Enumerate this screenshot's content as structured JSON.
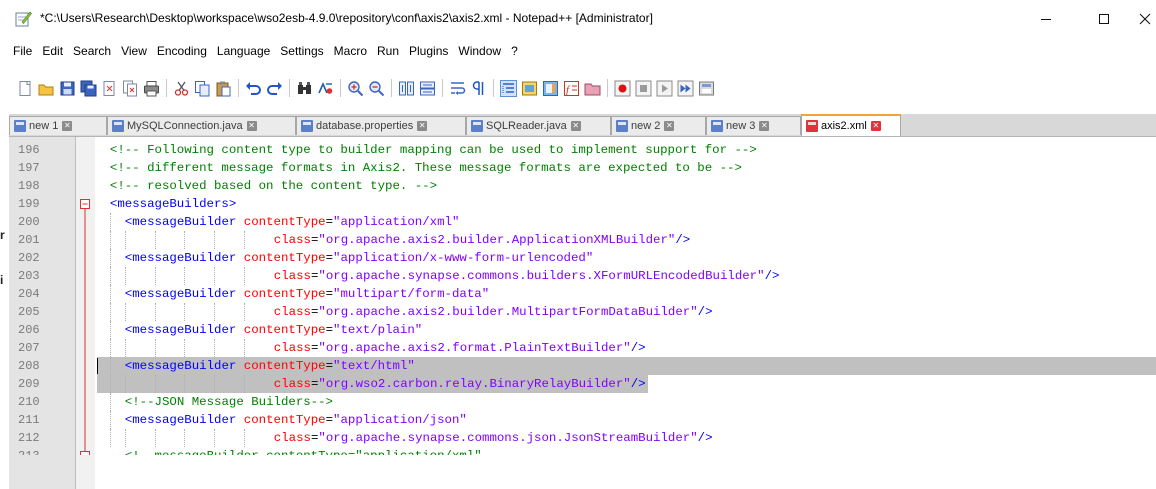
{
  "window": {
    "title": "*C:\\Users\\Research\\Desktop\\workspace\\wso2esb-4.9.0\\repository\\conf\\axis2\\axis2.xml - Notepad++ [Administrator]",
    "minimize_icon": "minimize-icon",
    "maximize_icon": "maximize-icon",
    "close_icon": "close-icon"
  },
  "left_edge": [
    "r",
    "i"
  ],
  "menu": [
    "File",
    "Edit",
    "Search",
    "View",
    "Encoding",
    "Language",
    "Settings",
    "Macro",
    "Run",
    "Plugins",
    "Window",
    "?"
  ],
  "toolbar": [
    {
      "name": "new-file-icon",
      "type": "btn"
    },
    {
      "name": "open-file-icon",
      "type": "btn"
    },
    {
      "name": "save-icon",
      "type": "btn"
    },
    {
      "name": "save-all-icon",
      "type": "btn"
    },
    {
      "name": "close-file-icon",
      "type": "btn"
    },
    {
      "name": "close-all-icon",
      "type": "btn"
    },
    {
      "name": "print-icon",
      "type": "btn"
    },
    {
      "type": "sep"
    },
    {
      "name": "cut-icon",
      "type": "btn"
    },
    {
      "name": "copy-icon",
      "type": "btn"
    },
    {
      "name": "paste-icon",
      "type": "btn"
    },
    {
      "type": "sep"
    },
    {
      "name": "undo-icon",
      "type": "btn"
    },
    {
      "name": "redo-icon",
      "type": "btn"
    },
    {
      "type": "sep"
    },
    {
      "name": "find-icon",
      "type": "btn"
    },
    {
      "name": "replace-icon",
      "type": "btn"
    },
    {
      "type": "sep"
    },
    {
      "name": "zoom-in-icon",
      "type": "btn"
    },
    {
      "name": "zoom-out-icon",
      "type": "btn"
    },
    {
      "type": "sep"
    },
    {
      "name": "sync-vertical-icon",
      "type": "btn"
    },
    {
      "name": "sync-horizontal-icon",
      "type": "btn"
    },
    {
      "type": "sep"
    },
    {
      "name": "word-wrap-icon",
      "type": "btn"
    },
    {
      "name": "show-all-characters-icon",
      "type": "btn"
    },
    {
      "type": "sep"
    },
    {
      "name": "indent-guide-icon",
      "type": "btn",
      "active": true
    },
    {
      "name": "user-defined-language-icon",
      "type": "btn"
    },
    {
      "name": "document-map-icon",
      "type": "btn"
    },
    {
      "name": "function-list-icon",
      "type": "btn"
    },
    {
      "name": "folder-as-workspace-icon",
      "type": "btn"
    },
    {
      "type": "sep"
    },
    {
      "name": "record-macro-icon",
      "type": "btn"
    },
    {
      "name": "stop-recording-icon",
      "type": "btn"
    },
    {
      "name": "play-macro-icon",
      "type": "btn"
    },
    {
      "name": "run-macro-multiple-icon",
      "type": "btn"
    },
    {
      "name": "save-macro-icon",
      "type": "btn"
    }
  ],
  "tabs": [
    {
      "label": "new 1",
      "color": "#5b7fc9",
      "active": false
    },
    {
      "label": "MySQLConnection.java",
      "color": "#5b7fc9",
      "active": false
    },
    {
      "label": "database.properties",
      "color": "#5b7fc9",
      "active": false
    },
    {
      "label": "SQLReader.java",
      "color": "#5b7fc9",
      "active": false
    },
    {
      "label": "new 2",
      "color": "#5b7fc9",
      "active": false
    },
    {
      "label": "new 3",
      "color": "#5b7fc9",
      "active": false
    },
    {
      "label": "axis2.xml",
      "color": "#e0343d",
      "active": true
    }
  ],
  "colors": {
    "comment": "#008000",
    "tag": "#0000ff",
    "attribute": "#ff0000",
    "string": "#8000ff",
    "selection": "#c0c0c0",
    "fold_marker": "#e03030"
  },
  "lines": [
    {
      "num": "196",
      "indent": 2,
      "tokens": [
        [
          "cm",
          "<!-- Following content type to builder mapping can be used to implement support for -->"
        ]
      ]
    },
    {
      "num": "197",
      "indent": 2,
      "tokens": [
        [
          "cm",
          "<!-- different message formats in Axis2. These message formats are expected to be -->"
        ]
      ]
    },
    {
      "num": "198",
      "indent": 2,
      "tokens": [
        [
          "cm",
          "<!-- resolved based on the content type. -->"
        ]
      ]
    },
    {
      "num": "199",
      "indent": 2,
      "fold": "open",
      "tokens": [
        [
          "tg",
          "<messageBuilders>"
        ]
      ]
    },
    {
      "num": "200",
      "indent": 4,
      "tokens": [
        [
          "tg",
          "<messageBuilder "
        ],
        [
          "at",
          "contentType"
        ],
        [
          "eq",
          "="
        ],
        [
          "st",
          "\"application/xml\""
        ]
      ]
    },
    {
      "num": "201",
      "indent": 4,
      "cont": true,
      "tokens": [
        [
          "at",
          "class"
        ],
        [
          "eq",
          "="
        ],
        [
          "st",
          "\"org.apache.axis2.builder.ApplicationXMLBuilder\""
        ],
        [
          "tg",
          "/>"
        ]
      ]
    },
    {
      "num": "202",
      "indent": 4,
      "tokens": [
        [
          "tg",
          "<messageBuilder "
        ],
        [
          "at",
          "contentType"
        ],
        [
          "eq",
          "="
        ],
        [
          "st",
          "\"application/x-www-form-urlencoded\""
        ]
      ]
    },
    {
      "num": "203",
      "indent": 4,
      "cont": true,
      "tokens": [
        [
          "at",
          "class"
        ],
        [
          "eq",
          "="
        ],
        [
          "st",
          "\"org.apache.synapse.commons.builders.XFormURLEncodedBuilder\""
        ],
        [
          "tg",
          "/>"
        ]
      ]
    },
    {
      "num": "204",
      "indent": 4,
      "tokens": [
        [
          "tg",
          "<messageBuilder "
        ],
        [
          "at",
          "contentType"
        ],
        [
          "eq",
          "="
        ],
        [
          "st",
          "\"multipart/form-data\""
        ]
      ]
    },
    {
      "num": "205",
      "indent": 4,
      "cont": true,
      "tokens": [
        [
          "at",
          "class"
        ],
        [
          "eq",
          "="
        ],
        [
          "st",
          "\"org.apache.axis2.builder.MultipartFormDataBuilder\""
        ],
        [
          "tg",
          "/>"
        ]
      ]
    },
    {
      "num": "206",
      "indent": 4,
      "tokens": [
        [
          "tg",
          "<messageBuilder "
        ],
        [
          "at",
          "contentType"
        ],
        [
          "eq",
          "="
        ],
        [
          "st",
          "\"text/plain\""
        ]
      ]
    },
    {
      "num": "207",
      "indent": 4,
      "cont": true,
      "tokens": [
        [
          "at",
          "class"
        ],
        [
          "eq",
          "="
        ],
        [
          "st",
          "\"org.apache.axis2.format.PlainTextBuilder\""
        ],
        [
          "tg",
          "/>"
        ]
      ]
    },
    {
      "num": "208",
      "indent": 4,
      "selected": true,
      "caret": true,
      "tokens": [
        [
          "tg",
          "<messageBuilder "
        ],
        [
          "at",
          "contentType"
        ],
        [
          "eq",
          "="
        ],
        [
          "st",
          "\"text/html\""
        ]
      ]
    },
    {
      "num": "209",
      "indent": 4,
      "cont": true,
      "selected": true,
      "tokens": [
        [
          "at",
          "class"
        ],
        [
          "eq",
          "="
        ],
        [
          "st",
          "\"org.wso2.carbon.relay.BinaryRelayBuilder\""
        ],
        [
          "tg",
          "/>"
        ]
      ]
    },
    {
      "num": "210",
      "indent": 4,
      "tokens": [
        [
          "cm",
          "<!--JSON Message Builders-->"
        ]
      ]
    },
    {
      "num": "211",
      "indent": 4,
      "tokens": [
        [
          "tg",
          "<messageBuilder "
        ],
        [
          "at",
          "contentType"
        ],
        [
          "eq",
          "="
        ],
        [
          "st",
          "\"application/json\""
        ]
      ]
    },
    {
      "num": "212",
      "indent": 4,
      "cont": true,
      "tokens": [
        [
          "at",
          "class"
        ],
        [
          "eq",
          "="
        ],
        [
          "st",
          "\"org.apache.synapse.commons.json.JsonStreamBuilder\""
        ],
        [
          "tg",
          "/>"
        ]
      ]
    },
    {
      "num": "213",
      "indent": 4,
      "fold": "box",
      "partial": true,
      "tokens": [
        [
          "cm",
          "<!--messageBuilder contentType=\"application/xml\""
        ]
      ]
    }
  ]
}
